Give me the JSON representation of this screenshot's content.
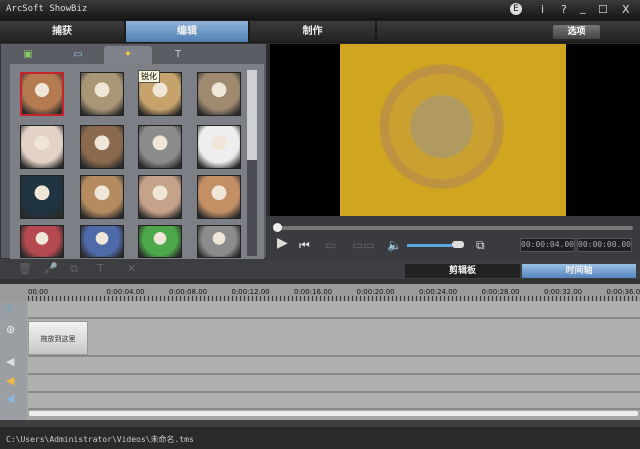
{
  "window": {
    "title": "ArcSoft ShowBiz",
    "buttons": [
      "E",
      "i",
      "?",
      "_",
      "☐",
      "X"
    ]
  },
  "main_tabs": [
    {
      "label": "捕获",
      "active": false
    },
    {
      "label": "编辑",
      "active": true
    },
    {
      "label": "制作",
      "active": false
    }
  ],
  "options_label": "选项",
  "effect_tabs": [
    {
      "icon": "transition-icon"
    },
    {
      "icon": "film-icon"
    },
    {
      "icon": "effects-star-icon",
      "active": true
    },
    {
      "icon": "text-icon"
    }
  ],
  "tooltip": "锐化",
  "thumb_colors": [
    [
      "#b47a50",
      "#a99676",
      "#c7a36c",
      "#9f8a70"
    ],
    [
      "#e3d3c6",
      "#8a6a4c",
      "#8b8b8b",
      "#eeeeee"
    ],
    [
      "#1f3340",
      "#b48c60",
      "#c6a28a",
      "#c39066"
    ],
    [
      "#b44a50",
      "#4e6aa8",
      "#4ca84a",
      "#8c8c8c"
    ]
  ],
  "player": {
    "timecode_current": "00:00:04.00",
    "timecode_total": "00:00:00.00",
    "volume": 0.85,
    "position": 0
  },
  "timeline": {
    "tabs": [
      {
        "label": "剪辑板",
        "active": false
      },
      {
        "label": "时间轴",
        "active": true
      }
    ],
    "ruler": [
      "00.00",
      "0:00:04.00",
      "0:00:08.00",
      "0:00:12.00",
      "0:00:16.00",
      "0:00:20.00",
      "0:00:24.00",
      "0:00:28.00",
      "0:00:32.00",
      "0:00:36.00"
    ],
    "clip_label": "拖放到这里"
  },
  "status_path": "C:\\Users\\Administrator\\Videos\\未命名.tms"
}
